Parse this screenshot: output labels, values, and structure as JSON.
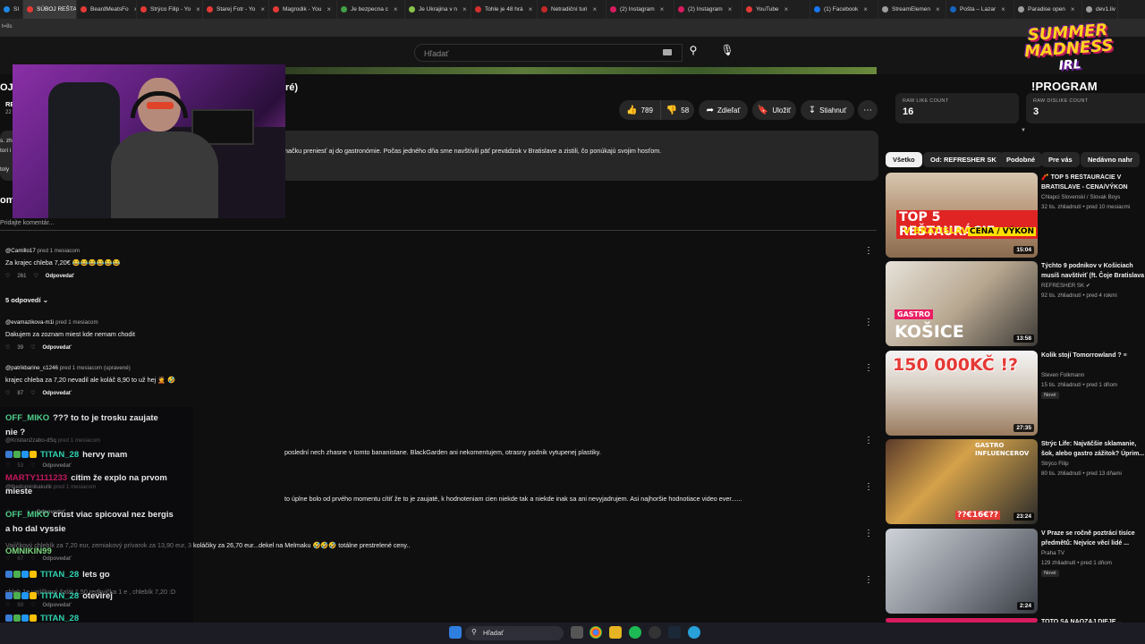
{
  "browser": {
    "tabs": [
      {
        "label": "SI",
        "color": "#1e88e5",
        "active": false
      },
      {
        "label": "SÚBOJ REŠTAU",
        "color": "#e53935",
        "active": true
      },
      {
        "label": "BeardMeatsFo",
        "color": "#e53935",
        "active": false
      },
      {
        "label": "Strýco Filip - Yo",
        "color": "#e53935",
        "active": false
      },
      {
        "label": "Starej Fotr - Yo",
        "color": "#e53935",
        "active": false
      },
      {
        "label": "Magrodik - You",
        "color": "#e53935",
        "active": false
      },
      {
        "label": "Je bezpecna c",
        "color": "#43a047",
        "active": false
      },
      {
        "label": "Je Ukrajina v n",
        "color": "#8bc34a",
        "active": false
      },
      {
        "label": "Tohle je 48 hrá",
        "color": "#d32f2f",
        "active": false
      },
      {
        "label": "Netradiční turi",
        "color": "#c62828",
        "active": false
      },
      {
        "label": "(2) Instagram",
        "color": "#d81b60",
        "active": false
      },
      {
        "label": "(2) Instagram",
        "color": "#d81b60",
        "active": false
      },
      {
        "label": "YouTube",
        "color": "#e53935",
        "active": false
      },
      {
        "label": "(1) Facebook",
        "color": "#1877f2",
        "active": false
      },
      {
        "label": "StreamElemen",
        "color": "#9e9e9e",
        "active": false
      },
      {
        "label": "Pošta – Lazar",
        "color": "#1565c0",
        "active": false
      },
      {
        "label": "Paradise open",
        "color": "#9e9e9e",
        "active": false
      },
      {
        "label": "dev1.liv",
        "color": "#9e9e9e",
        "active": false
      }
    ],
    "address_fragment": "t=8s"
  },
  "youtube": {
    "search_placeholder": "Hľadať",
    "title_fragment_left": "OJ",
    "title_fragment_right": "ré)",
    "channel_fragment": "RE",
    "subs_fragment": "22",
    "actions": {
      "likes": "789",
      "dislikes": "58",
      "share": "Zdieľať",
      "save": "Uložiť",
      "download": "Stiahnuť"
    },
    "description_text": "načku preniesť aj do gastronómie. Počas jedného dňa sme navštívili päť prevádzok v Bratislave a zistili, čo ponúkajú svojim hosťom.",
    "desc_side_fragments": [
      "s. zh",
      "tori i",
      "toly"
    ],
    "comments_fragment": "om",
    "comment_placeholder": "Pridajte komentár..."
  },
  "comments": [
    {
      "author": "@Camillo17",
      "time": "pred 1 mesiacom",
      "text": "Za krajec chleba 7,20€ 😂😂😂😂😂😂",
      "likes": "261",
      "reply_label": "Odpovedať"
    },
    {
      "author": "@evamazikova-m1i",
      "time": "pred 1 mesiacom",
      "text": "Dakujem za zoznam miest kde nemam chodit",
      "likes": "39",
      "reply_label": "Odpovedať"
    },
    {
      "author": "@patrikbarine_c1246",
      "time": "pred 1 mesiacom (upravené)",
      "text": "krajec chleba za 7,20 nevadil ale koláč 8,90 to už hej 🤦 🤣",
      "likes": "87",
      "reply_label": "Odpovedať"
    },
    {
      "author": "@Kristian2zabo-dSq",
      "time": "pred 1 mesiacom",
      "text": "poslední nech zhasne v tomto bananistane. BlackGarden ani nekomentujem, otrasny podnik vytupenej plastiky.",
      "likes": "53",
      "reply_label": "Odpovedať"
    },
    {
      "author": "@thedominikakulik",
      "time": "pred 1 mesiacom",
      "text": "to úplne bolo od prvého momentu cítiť že to je zaujaté, k hodnoteniam cien niekde tak a niekde inak sa ani nevyjadrujem. Asi najhoršie hodnotiace video ever......",
      "likes": "",
      "reply_label": "Odpovedať"
    },
    {
      "author": "",
      "time": "",
      "text": "Vajíčkový chlebík za 7,20 eur, zemiakový prívarok za 13,90 eur, 3 koláčiky za 26,70 eur...dekel na Melmaku 🤣🤣🤣 totálne prestrelené ceny..",
      "likes": "67",
      "reply_label": "Odpovedať"
    },
    {
      "author": "",
      "time": "",
      "text": "chleb 1e vajíčkový šalát 1,50 redkvička 1 e , chlebík 7,20 :D",
      "likes": "99",
      "reply_label": "Odpovedať"
    }
  ],
  "replies_toggle": "5 odpovedí",
  "chat": [
    {
      "user": "OFF_MIKO",
      "color": "#4fd18b",
      "text": "??? to to je trosku zaujate",
      "badges": 0
    },
    {
      "user": "",
      "color": "#e6e6e6",
      "text": "nie ?",
      "badges": 0
    },
    {
      "user": "TITAN_28",
      "color": "#2fd3b0",
      "text": "hervy mam",
      "badges": 4
    },
    {
      "user": "MARTY1111233",
      "color": "#c2185b",
      "text": "citim že explo na prvom",
      "badges": 0
    },
    {
      "user": "",
      "color": "#e6e6e6",
      "text": "mieste",
      "badges": 0
    },
    {
      "user": "OFF_MIKO",
      "color": "#4fd18b",
      "text": "crust viac spicoval nez bergis",
      "badges": 0
    },
    {
      "user": "",
      "color": "#e6e6e6",
      "text": "a ho dal vyssie",
      "badges": 0
    },
    {
      "user": "OMNIKIN99",
      "color": "#7cd67c",
      "text": "",
      "badges": 0
    },
    {
      "user": "TITAN_28",
      "color": "#2fd3b0",
      "text": "lets go",
      "badges": 4
    },
    {
      "user": "TITAN_28",
      "color": "#2fd3b0",
      "text": "otevirej",
      "badges": 4
    },
    {
      "user": "TITAN_28",
      "color": "#2fd3b0",
      "text": "",
      "badges": 4
    }
  ],
  "overlay": {
    "logo_line1": "SUMMER",
    "logo_line2": "MADNESS",
    "logo_line3": "IRL",
    "program": "!PROGRAM"
  },
  "sidebar": {
    "raw_like_label": "RAW LIKE COUNT",
    "raw_like_value": "16",
    "raw_dislike_label": "RAW DISLIKE COUNT",
    "raw_dislike_value": "3",
    "chips": [
      "Všetko",
      "Od: REFRESHER SK",
      "Podobné",
      "Pre vás",
      "Nedávno nahr"
    ],
    "videos": [
      {
        "title": "🧨 TOP 5 REŠTAURÁCIE V BRATISLAVE - CENA/VÝKON",
        "channel": "Chlapci Slovenskí / Slovak Boys",
        "meta": "32 tis. zhliadnutí • pred 10 mesiacmi",
        "duration": "15:04",
        "badge": "",
        "caption1": "TOP 5 REŠTAURÁCIE",
        "caption2": "V BRATISLAVE",
        "caption3": "CENA / VÝKON"
      },
      {
        "title": "Týchto 9 podnikov v Košiciach musíš navštíviť (ft. Čoje Bratislava",
        "channel": "REFRESHER SK ✔",
        "meta": "92 tis. zhliadnutí • pred 4 rokmi",
        "duration": "13:58",
        "badge": "",
        "caption1": "GASTRO",
        "caption2": "KOŠICE",
        "caption3": ""
      },
      {
        "title": "Kolik stojí Tomorrowland ? ≡",
        "channel": "Steven Folkmann",
        "meta": "15 tis. zhliadnutí • pred 1 dňom",
        "duration": "27:35",
        "badge": "Nové",
        "caption1": "150 000KČ !?",
        "caption2": "",
        "caption3": ""
      },
      {
        "title": "Strýc Life: Najväčšie sklamanie, šok, alebo gastro zážitok? Úprim...",
        "channel": "Strýco Filip",
        "meta": "80 tis. zhliadnutí • pred 13 dňami",
        "duration": "23:24",
        "badge": "",
        "caption1": "GASTRO INFLUENCEROV",
        "caption2": "??€16€??",
        "caption3": ""
      },
      {
        "title": "V Praze se ročně poztrácí tisíce předmětů: Nejvíce věcí lidé ...",
        "channel": "Praha TV",
        "meta": "129 zhliadnutí • pred 1 dňom",
        "duration": "2:24",
        "badge": "Nové",
        "caption1": "",
        "caption2": "",
        "caption3": ""
      }
    ],
    "next_title_fragment": "TOTO SA NAOZAJ DIEJE..."
  },
  "taskbar": {
    "search_label": "Hľadať"
  }
}
